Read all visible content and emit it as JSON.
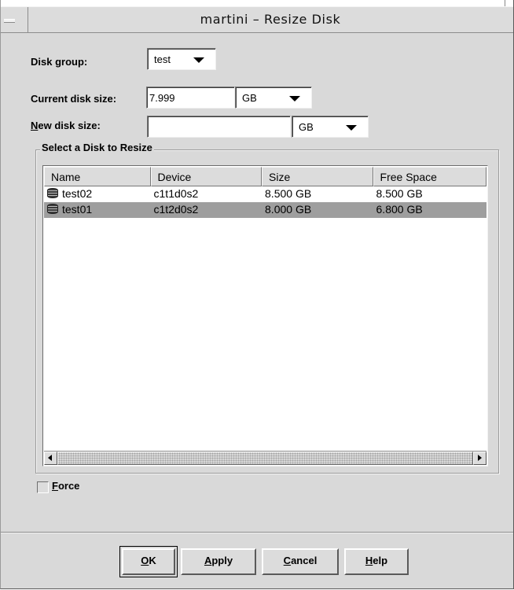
{
  "window": {
    "title": "martini – Resize Disk"
  },
  "form": {
    "disk_group": {
      "label_pre": "Disk ",
      "label_mnemonic": "g",
      "label_post": "roup:",
      "value": "test"
    },
    "current_size": {
      "label": "Current disk size:",
      "value": "7.999",
      "unit": "GB"
    },
    "new_size": {
      "label_mnemonic": "N",
      "label_post": "ew disk size:",
      "value": "",
      "unit": "GB"
    }
  },
  "disk_group_box": {
    "title": "Select a Disk to Resize",
    "columns": [
      "Name",
      "Device",
      "Size",
      "Free Space"
    ],
    "rows": [
      {
        "name": "test02",
        "device": "c1t1d0s2",
        "size": "8.500 GB",
        "free": "8.500 GB",
        "selected": false,
        "icon": "disk-icon"
      },
      {
        "name": "test01",
        "device": "c1t2d0s2",
        "size": "8.000 GB",
        "free": "6.800 GB",
        "selected": true,
        "icon": "disk-icon"
      }
    ]
  },
  "force": {
    "label_mnemonic": "F",
    "label_post": "orce",
    "checked": false
  },
  "buttons": {
    "ok": {
      "mnemonic": "O",
      "rest": "K"
    },
    "apply": {
      "mnemonic": "A",
      "rest": "pply"
    },
    "cancel": {
      "mnemonic": "C",
      "rest": "ancel"
    },
    "help": {
      "mnemonic": "H",
      "rest": "elp"
    }
  },
  "colors": {
    "background": "#d9d9d9",
    "selected_row": "#9e9e9e"
  }
}
